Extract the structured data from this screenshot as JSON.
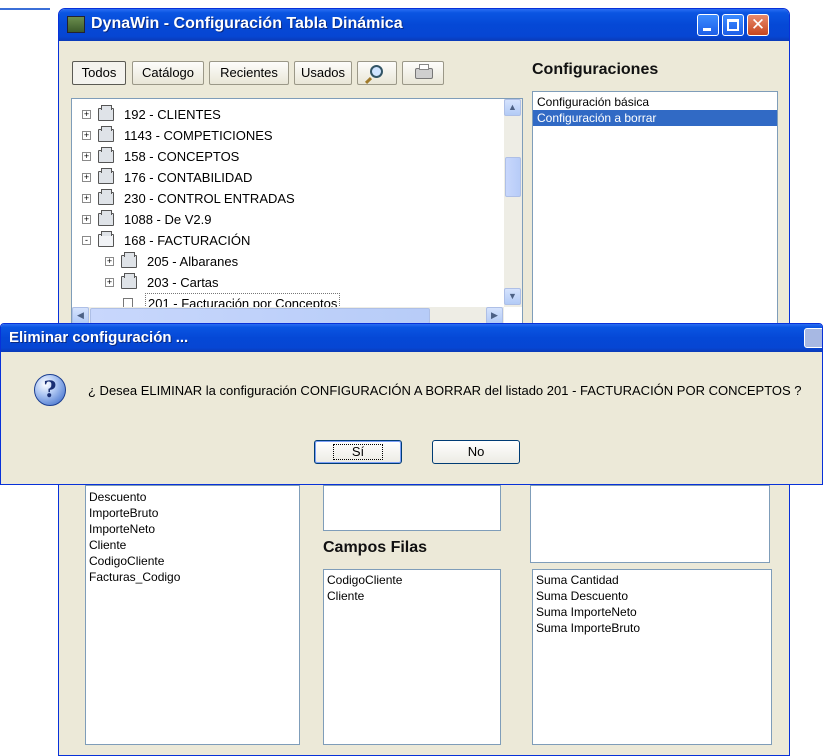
{
  "main_window": {
    "title": "DynaWin - Configuración Tabla Dinámica",
    "toolbar": {
      "tabs": [
        "Todos",
        "Catálogo",
        "Recientes",
        "Usados"
      ]
    },
    "tree": {
      "items": [
        {
          "label": "192 - CLIENTES",
          "level": 0,
          "expander": "+"
        },
        {
          "label": "1143 - COMPETICIONES",
          "level": 0,
          "expander": "+"
        },
        {
          "label": "158 - CONCEPTOS",
          "level": 0,
          "expander": "+"
        },
        {
          "label": "176 - CONTABILIDAD",
          "level": 0,
          "expander": "+"
        },
        {
          "label": "230 - CONTROL ENTRADAS",
          "level": 0,
          "expander": "+"
        },
        {
          "label": "1088 - De V2.9",
          "level": 0,
          "expander": "+"
        },
        {
          "label": "168 - FACTURACIÓN",
          "level": 0,
          "expander": "-"
        },
        {
          "label": "205 - Albaranes",
          "level": 1,
          "expander": "+"
        },
        {
          "label": "203 - Cartas",
          "level": 1,
          "expander": "+"
        },
        {
          "label": "201 - Facturación por Conceptos",
          "level": 1,
          "expander": ""
        }
      ]
    },
    "configuraciones": {
      "title": "Configuraciones",
      "items": [
        {
          "label": "Configuración básica",
          "selected": false
        },
        {
          "label": "Configuración a borrar",
          "selected": true
        }
      ]
    },
    "fields_list": [
      "Descuento",
      "ImporteBruto",
      "ImporteNeto",
      "Cliente",
      "CodigoCliente",
      "Facturas_Codigo"
    ],
    "campos_filas": {
      "title": "Campos Filas",
      "items": [
        "CodigoCliente",
        "Cliente"
      ]
    },
    "values_list": [
      "Suma Cantidad",
      "Suma Descuento",
      "Suma ImporteNeto",
      "Suma ImporteBruto"
    ]
  },
  "dialog": {
    "title": "Eliminar configuración ...",
    "message": "¿ Desea ELIMINAR la configuración CONFIGURACIÓN A BORRAR del listado 201 - FACTURACIÓN POR CONCEPTOS ?",
    "yes_label": "Sí",
    "no_label": "No"
  }
}
